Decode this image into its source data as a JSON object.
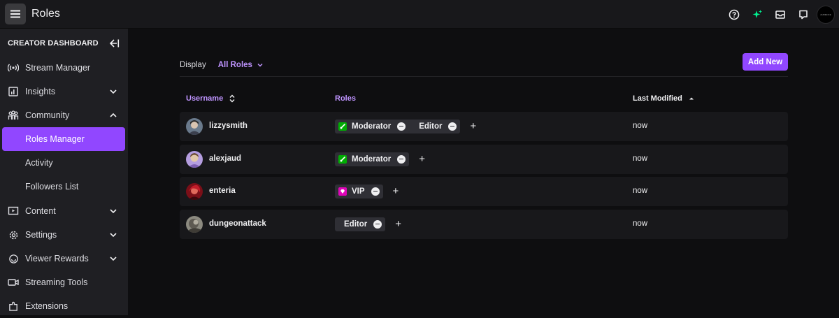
{
  "header": {
    "title": "Roles",
    "icons": [
      "help-icon",
      "sparkle-icon",
      "inbox-icon",
      "whispers-icon"
    ],
    "avatar_text": "AUDIENCE"
  },
  "sidebar": {
    "title": "CREATOR DASHBOARD",
    "items": [
      {
        "label": "Stream Manager",
        "icon": "broadcast-icon"
      },
      {
        "label": "Insights",
        "icon": "insights-icon"
      },
      {
        "label": "Community",
        "icon": "community-icon"
      },
      {
        "label": "Roles Manager"
      },
      {
        "label": "Activity"
      },
      {
        "label": "Followers List"
      },
      {
        "label": "Content",
        "icon": "content-icon"
      },
      {
        "label": "Settings",
        "icon": "settings-icon"
      },
      {
        "label": "Viewer Rewards",
        "icon": "rewards-icon"
      },
      {
        "label": "Streaming Tools",
        "icon": "camera-icon"
      },
      {
        "label": "Extensions",
        "icon": "extensions-icon"
      }
    ]
  },
  "toolbar": {
    "display_label": "Display",
    "filter_value": "All Roles",
    "add_new_label": "Add New"
  },
  "table": {
    "columns": [
      "Username",
      "Roles",
      "Last Modified"
    ],
    "rows": [
      {
        "username": "lizzysmith",
        "roles": [
          "Moderator",
          "Editor"
        ],
        "last_modified": "now"
      },
      {
        "username": "alexjaud",
        "roles": [
          "Moderator"
        ],
        "last_modified": "now"
      },
      {
        "username": "enteria",
        "roles": [
          "VIP"
        ],
        "last_modified": "now"
      },
      {
        "username": "dungeonattack",
        "roles": [
          "Editor"
        ],
        "last_modified": "now"
      }
    ]
  },
  "colors": {
    "accent": "#9147ff",
    "accent_text": "#bf94ff",
    "moderator_badge": "#00ad03",
    "vip_badge": "#e005b9"
  }
}
